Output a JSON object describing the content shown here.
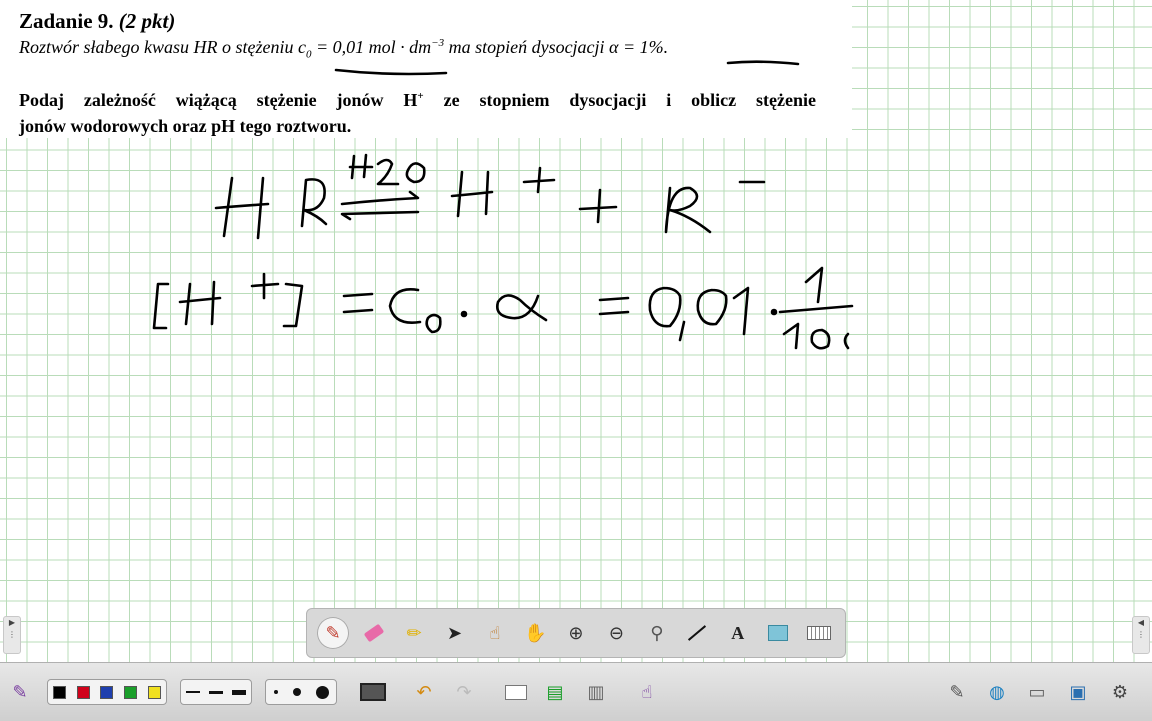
{
  "task": {
    "title_main": "Zadanie 9.",
    "title_points": "(2 pkt)",
    "line1_a": "Roztwór słabego kwasu HR o stężeniu c",
    "line1_c_sub": "0",
    "line1_b": " = 0,01 mol · dm",
    "line1_exp": "−3",
    "line1_c": " ma stopień dysocjacji  α  = 1%.",
    "line2_a": "Podaj zależność wiążącą stężenie jonów H",
    "line2_sup": "+",
    "line2_b": " ze stopniem dysocjacji i oblicz stężenie",
    "line3": "jonów wodorowych oraz pH tego roztworu."
  },
  "colors": {
    "grid": "#b9dcb9",
    "ink": "#000000",
    "toolbar": "#d8d8d8",
    "bottom_bar": "#d6d6d6"
  },
  "floating_toolbar": {
    "tools": [
      "pen-icon",
      "eraser-icon",
      "highlighter-icon",
      "select-arrow-icon",
      "magic-pointer-icon",
      "pan-hand-icon",
      "zoom-in-icon",
      "zoom-out-icon",
      "color-picker-icon",
      "line-icon",
      "text-tool-icon",
      "screen-shade-icon",
      "keyboard-icon"
    ],
    "text_tool_label": "A"
  },
  "bottom_toolbar": {
    "colors": [
      "#000000",
      "#d0021b",
      "#1f3fae",
      "#1a9e2a",
      "#f0e020"
    ],
    "icons": [
      "pen-icon",
      "screen-capture-icon",
      "undo-icon",
      "redo-icon",
      "add-page-icon",
      "page-sorter-icon",
      "gallery-icon",
      "properties-icon",
      "settings-icon",
      "globe-icon",
      "folder-icon",
      "display-icon",
      "gear-icon"
    ]
  }
}
